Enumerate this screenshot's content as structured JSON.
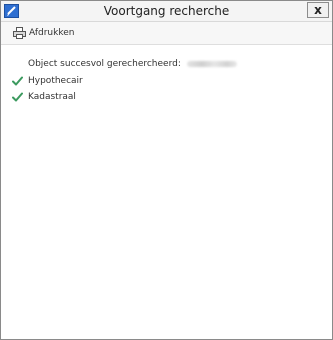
{
  "window": {
    "title": "Voortgang recherche",
    "close_label": "x"
  },
  "toolbar": {
    "print_label": "Afdrukken",
    "print_icon": "printer-icon"
  },
  "progress": {
    "status_text": "Object succesvol gerechercheerd:",
    "items": [
      {
        "label": "Hypothecair",
        "icon": "checkmark-icon"
      },
      {
        "label": "Kadastraal",
        "icon": "checkmark-icon"
      }
    ]
  },
  "colors": {
    "check": "#3c9a5f",
    "app_icon": "#2f6fd1"
  }
}
